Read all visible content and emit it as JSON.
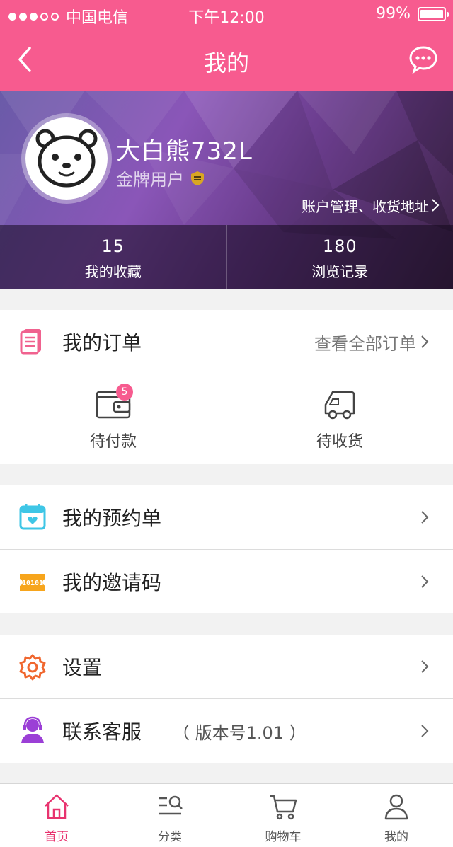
{
  "status_bar": {
    "carrier": "中国电信",
    "time": "下午12:00",
    "battery": "99%"
  },
  "nav": {
    "title": "我的",
    "back_icon": "chevron-left-icon",
    "message_icon": "chat-bubble-icon"
  },
  "profile": {
    "name": "大白熊732L",
    "level": "金牌用户",
    "account_link": "账户管理、收货地址",
    "stats": [
      {
        "value": "15",
        "label": "我的收藏"
      },
      {
        "value": "180",
        "label": "浏览记录"
      }
    ]
  },
  "orders": {
    "title": "我的订单",
    "view_all": "查看全部订单",
    "items": [
      {
        "label": "待付款",
        "badge": "5",
        "icon": "wallet-icon"
      },
      {
        "label": "待收货",
        "icon": "truck-icon"
      }
    ]
  },
  "menu": {
    "reservations": "我的预约单",
    "invite_code": "我的邀请码",
    "settings": "设置",
    "support": "联系客服",
    "version": "（ 版本号1.01 ）"
  },
  "colors": {
    "accent": "#f75b8f",
    "tab_active": "#e8336f"
  },
  "tabbar": [
    {
      "label": "首页",
      "icon": "home-icon",
      "active": true
    },
    {
      "label": "分类",
      "icon": "category-search-icon",
      "active": false
    },
    {
      "label": "购物车",
      "icon": "cart-icon",
      "active": false
    },
    {
      "label": "我的",
      "icon": "user-icon",
      "active": false
    }
  ]
}
